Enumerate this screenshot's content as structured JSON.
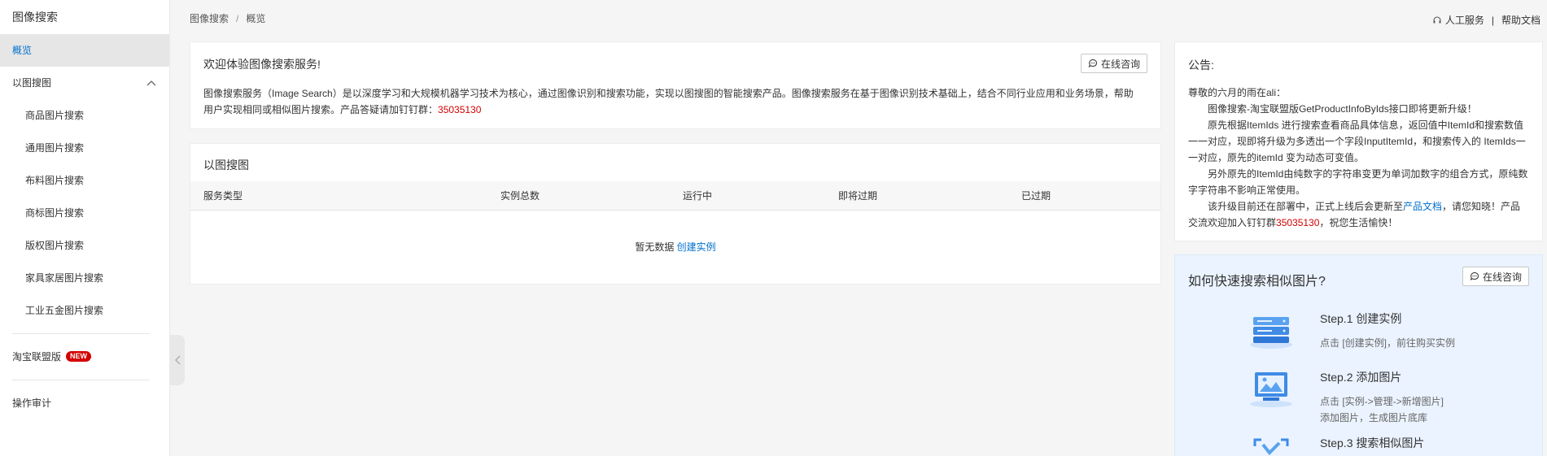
{
  "sidebar": {
    "title": "图像搜索",
    "overview": "概览",
    "group_label": "以图搜图",
    "sub_items": [
      "商品图片搜索",
      "通用图片搜索",
      "布料图片搜索",
      "商标图片搜索",
      "版权图片搜索",
      "家具家居图片搜索",
      "工业五金图片搜索"
    ],
    "taobao_label": "淘宝联盟版",
    "taobao_badge": "NEW",
    "audit_label": "操作审计"
  },
  "topbar": {
    "breadcrumb_root": "图像搜索",
    "breadcrumb_sep": "/",
    "breadcrumb_current": "概览",
    "service_link": "人工服务",
    "link_sep": "|",
    "docs_link": "帮助文档"
  },
  "welcome": {
    "title": "欢迎体验图像搜索服务!",
    "consult_label": "在线咨询",
    "text": "图像搜索服务（Image Search）是以深度学习和大规模机器学习技术为核心，通过图像识别和搜索功能，实现以图搜图的智能搜索产品。图像搜索服务在基于图像识别技术基础上，结合不同行业应用和业务场景，帮助用户实现相同或相似图片搜索。产品答疑请加钉钉群：",
    "group_number": "35035130"
  },
  "table": {
    "title": "以图搜图",
    "columns": [
      "服务类型",
      "实例总数",
      "运行中",
      "即将过期",
      "已过期"
    ],
    "empty_text": "暂无数据",
    "create_link": "创建实例"
  },
  "notice": {
    "title": "公告:",
    "greeting": "尊敬的六月的雨在ali：",
    "p1": "图像搜索-淘宝联盟版GetProductInfoByIds接口即将更新升级！",
    "p2": "原先根据ItemIds 进行搜索查看商品具体信息，返回值中ItemId和搜索数值一一对应，现即将升级为多透出一个字段InputItemId，和搜索传入的 ItemIds一一对应，原先的itemId 变为动态可变值。",
    "p3": "另外原先的ItemId由纯数字的字符串变更为单词加数字的组合方式，原纯数字字符串不影响正常使用。",
    "p4_a": "该升级目前还在部署中，正式上线后会更新至",
    "p4_link": "产品文档",
    "p4_b": "，请您知晓！产品交流欢迎加入钉钉群",
    "p4_group": "35035130",
    "p4_c": "，祝您生活愉快！"
  },
  "guide": {
    "title": "如何快速搜索相似图片?",
    "consult_label": "在线咨询",
    "steps": [
      {
        "title": "Step.1 创建实例",
        "desc": "点击 [创建实例]，前往购买实例",
        "desc2": ""
      },
      {
        "title": "Step.2 添加图片",
        "desc": "点击 [实例->管理->新增图片]",
        "desc2": "添加图片，生成图片底库"
      },
      {
        "title": "Step.3 搜索相似图片",
        "desc": "",
        "desc2": ""
      }
    ]
  },
  "icons": {
    "consult": "chat-bubble-icon",
    "service": "headset-icon",
    "collapse": "chevron-left-icon",
    "group": "chevron-up-icon"
  },
  "colors": {
    "link_blue": "#0070cc",
    "accent_red": "#d40000",
    "guide_bg": "#eaf3ff"
  }
}
